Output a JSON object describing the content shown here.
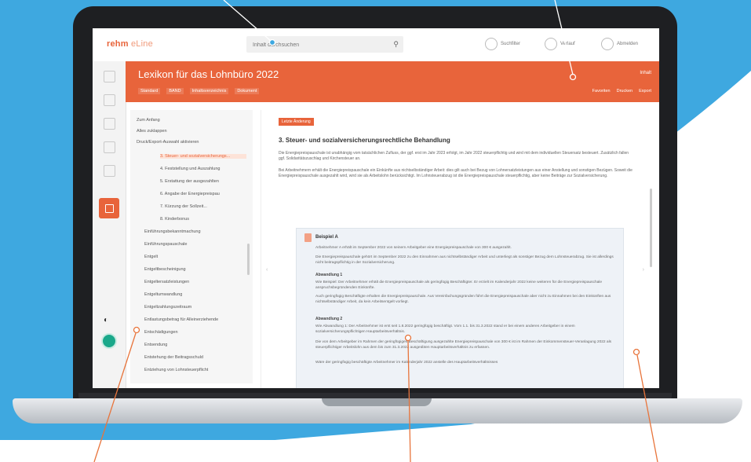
{
  "colors": {
    "brand": "#e8643b",
    "background_accent": "#3ea8e0",
    "callout_light": "#ffffff",
    "callout_orange": "#e8743b",
    "success": "#1aa88a"
  },
  "app": {
    "logo_main": "rehm",
    "logo_line": "eLine"
  },
  "search": {
    "placeholder": "Inhalt durchsuchen"
  },
  "topnav": {
    "item1": "Suchfilter",
    "item2": "Verlauf",
    "item3": "Abmelden"
  },
  "document": {
    "title": "Lexikon für das Lohnbüro 2022",
    "right_link": "Inhalt",
    "toolbar": [
      "Standard",
      "BAND",
      "Inhaltsverzeichnis",
      "Dokument"
    ],
    "actions": [
      "Favoriten",
      "Drucken",
      "Export"
    ]
  },
  "toc": {
    "items": [
      "Zum Anfang",
      "Alles zuklappen",
      "Druck/Export-Auswahl aktivieren",
      "3. Steuer- und sozialversicherungs...",
      "4. Feststellung und Auszahlung",
      "5. Erstattung der ausgezahlten",
      "6. Angabe der Energiepreispau",
      "7. Kürzung der Sollzeit...",
      "8. Kinderbonus",
      "Einführungsbekanntmachung",
      "Einführungspauschale",
      "Entgelt",
      "Entgeltbescheinigung",
      "Entgeltersatzleistungen",
      "Entgeltumwandlung",
      "Entgeltzahlungszeitraum",
      "Entlastungsbetrag für Alleinerziehende",
      "Entschädigungen",
      "Entsendung",
      "Entstehung der Beitragsschuld",
      "Entziehung von Lohnsteuerpflicht"
    ]
  },
  "content": {
    "badge": "Letzte Änderung",
    "heading": "3. Steuer- und sozialversicherungsrechtliche Behandlung",
    "para1": "Die Energiepreispauschale ist unabhängig vom tatsächlichen Zufluss, der ggf. erst im Jahr 2023 erfolgt, im Jahr 2022 steuerpflichtig und wird mit dem individuellen Steuersatz besteuert. Zusätzlich fallen ggf. Solidaritätszuschlag und Kirchensteuer an.",
    "para2": "Bei Arbeitnehmern erhält die Energiepreispauschale ein Einkünfte aus nichtselbständiger Arbeit: dies gilt auch bei Bezug von Lohnersatzleistungen aus einer Anstellung und sonstigen Bezügen. Soweit die Energiepreispauschale ausgezahlt wird, wird sie als Arbeitslohn berücksichtigt. Im Lohnsteuerabzug ist die Energiepreispauschale steuerpflichtig, aber keine Beiträge zur Sozialversicherung.",
    "example_title": "Beispiel A",
    "example_p1": "Arbeitnehmer A erhält im September 2022 von seinem Arbeitgeber eine Energiepreispauschale von 300 € ausgezahlt.",
    "example_p2": "Die Energiepreispauschale gehört im September 2022 zu den Einnahmen aus nichtselbständiger Arbeit und unterliegt als sonstiger Bezug dem Lohnsteuerabzug. Sie ist allerdings nicht beitragspflichtig in der Sozialversicherung.",
    "variant1": "Abwandlung 1",
    "variant1_p": "Wie Beispiel: Der Arbeitnehmer erhält die Energiepreispauschale als geringfügig Beschäftigter. Er erzielt im Kalenderjahr 2022 keine weiteren für die Energiepreispauschale anspruchsbegründenden Einkünfte.",
    "variant1_p2": "Auch geringfügig Beschäftigte erhalten die Energiepreispauschale. Aus Vereinfachungsgründen führt die Energiepreispauschale aber nicht zu Einnahmen bei den Einkünften aus nichtselbständiger Arbeit, da kein Arbeitsentgelt vorliegt.",
    "variant2": "Abwandlung 2",
    "variant2_p": "Wie Abwandlung 1: Der Arbeitnehmer ist erst seit 1.8.2022 geringfügig beschäftigt. Vom 1.1. bis 31.3.2022 stand er bei einem anderen Arbeitgeber in einem sozialversicherungspflichtigen Hauptarbeitsverhältnis.",
    "variant2_p2": "Die von dem Arbeitgeber im Rahmen der geringfügigen Beschäftigung ausgezahlte Energiepreispauschale von 300 € ist im Rahmen der Einkommensteuer-Veranlagung 2022 als steuerpflichtiger Arbeitslohn aus dem bis zum 31.3.2022 ausgeübten Hauptarbeitsverhältnis zu erfassen.",
    "variant2_p3": "Wäre der geringfügig beschäftigte Arbeitnehmer im Kalenderjahr 2022 anstelle des Hauptarbeitsverhältnisses"
  }
}
